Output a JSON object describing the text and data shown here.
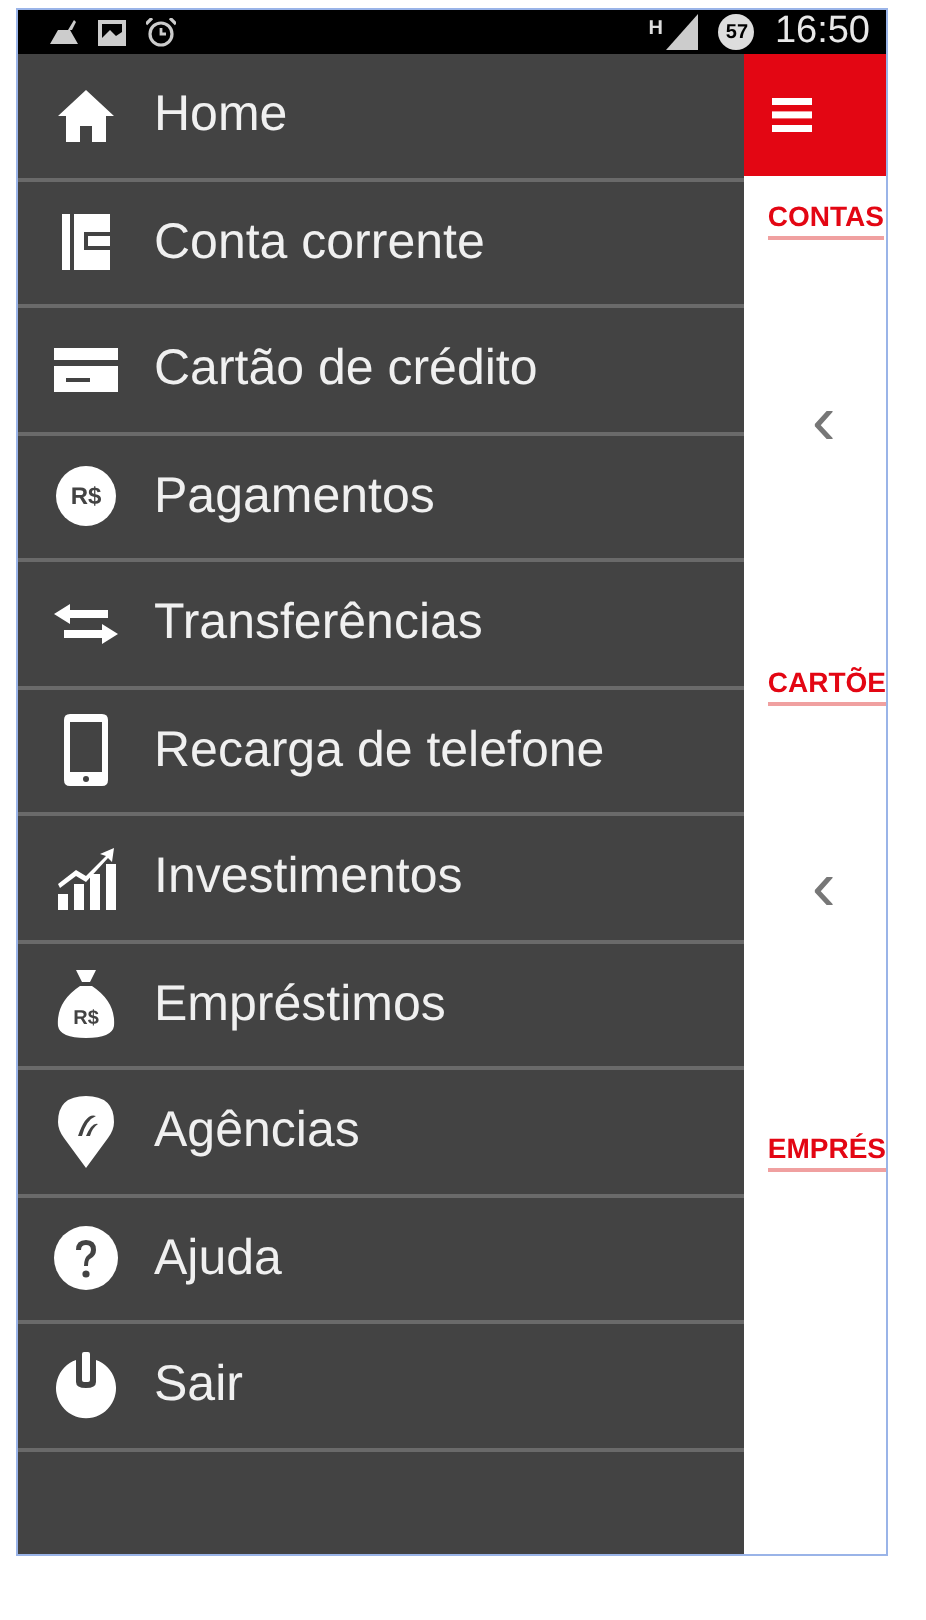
{
  "status_bar": {
    "network": "H",
    "battery": "57",
    "time": "16:50"
  },
  "menu": {
    "items": [
      {
        "label": "Home"
      },
      {
        "label": "Conta corrente"
      },
      {
        "label": "Cartão de crédito"
      },
      {
        "label": "Pagamentos",
        "icon_text": "R$"
      },
      {
        "label": "Transferências"
      },
      {
        "label": "Recarga de telefone"
      },
      {
        "label": "Investimentos"
      },
      {
        "label": "Empréstimos",
        "icon_text": "R$"
      },
      {
        "label": "Agências"
      },
      {
        "label": "Ajuda"
      },
      {
        "label": "Sair"
      }
    ]
  },
  "content": {
    "sections": [
      {
        "title": "CONTAS"
      },
      {
        "title": "CARTÕE"
      },
      {
        "title": "EMPRÉS"
      }
    ],
    "carousel_arrows": [
      "‹",
      "‹"
    ]
  }
}
